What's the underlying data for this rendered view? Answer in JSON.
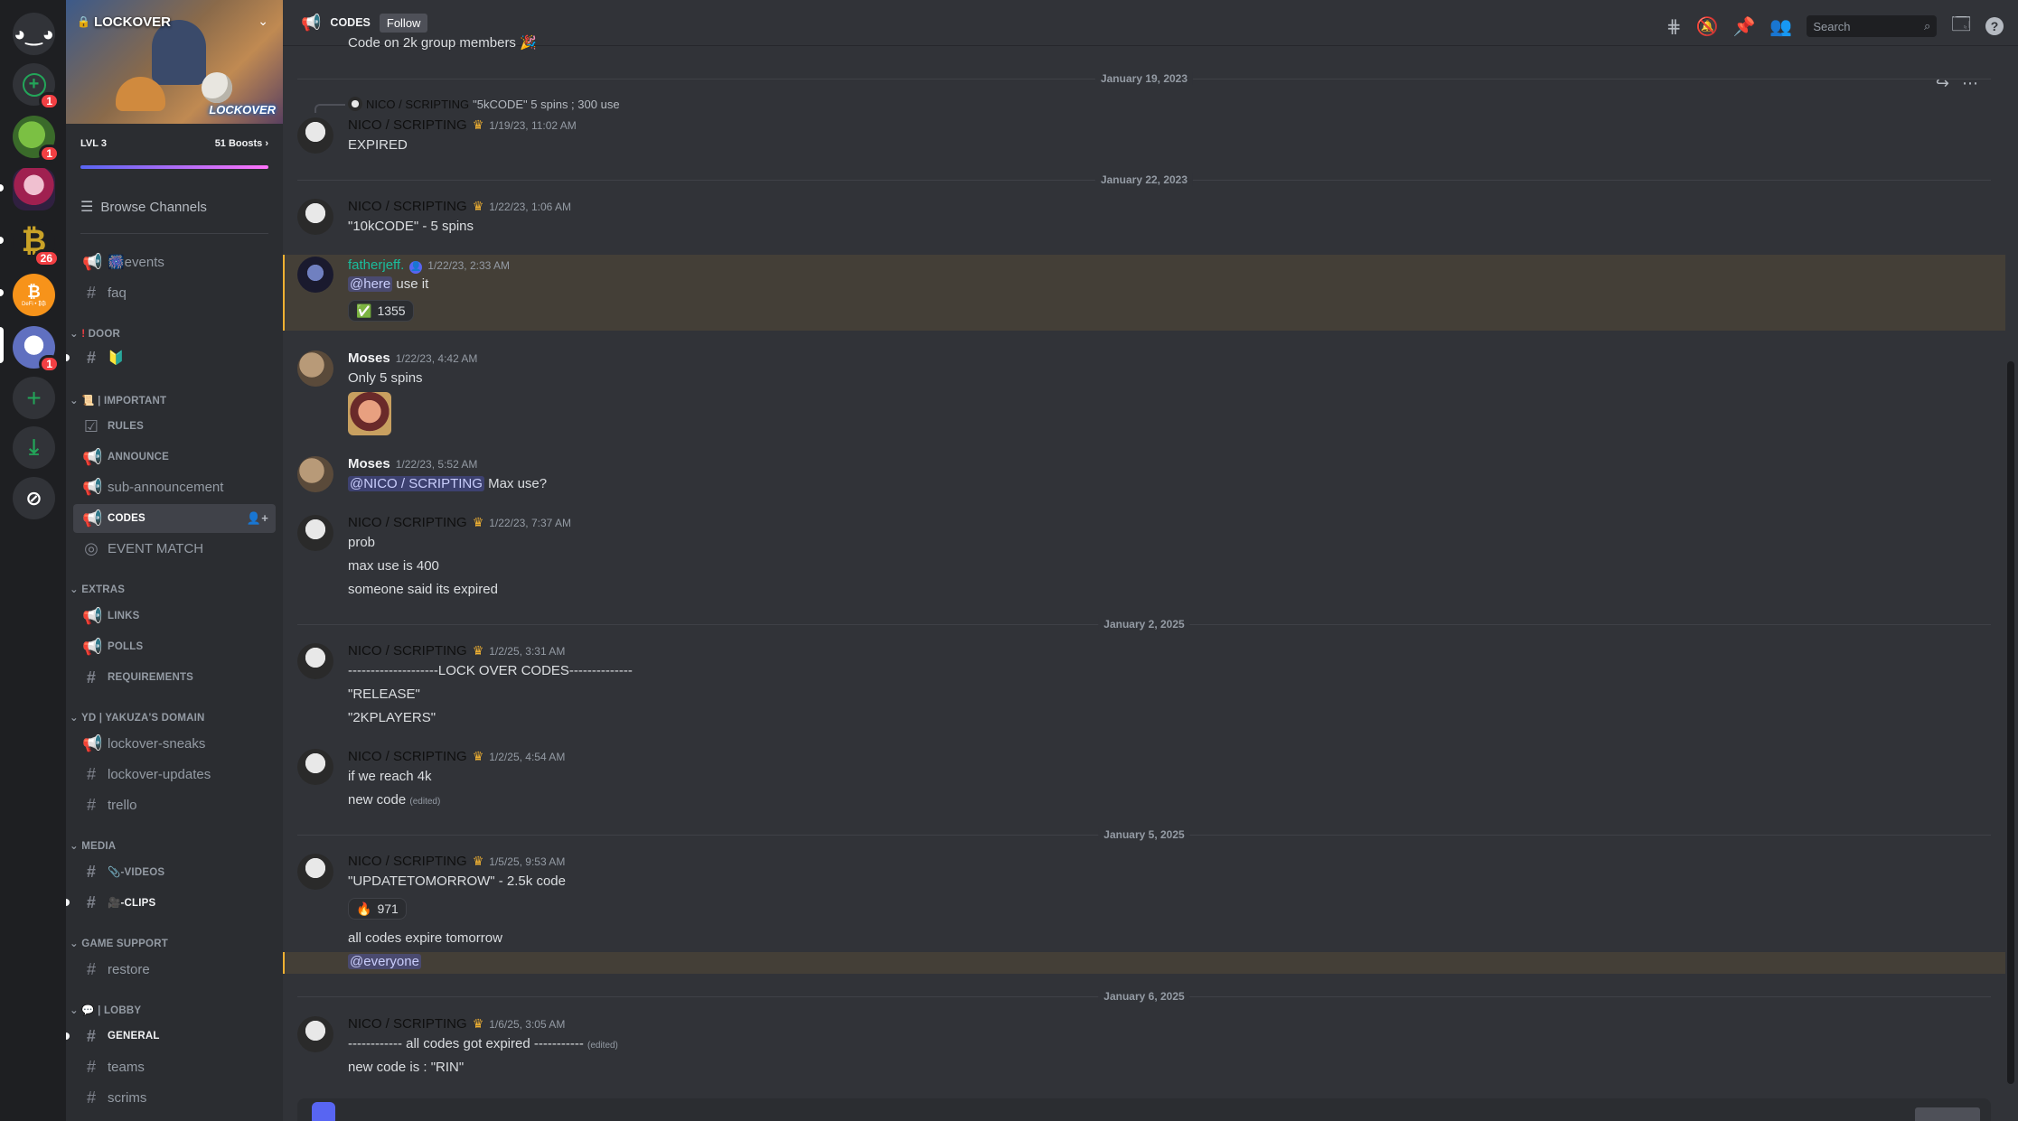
{
  "rail": {
    "servers": [
      {
        "name": "discord-home",
        "badge": ""
      },
      {
        "name": "add-server",
        "badge": "1"
      },
      {
        "name": "turtle-server",
        "badge": "1"
      },
      {
        "name": "anime-server",
        "badge": ""
      },
      {
        "name": "bitcoin-gold-server",
        "badge": "26"
      },
      {
        "name": "bitcoin-server",
        "badge": ""
      },
      {
        "name": "lockover-server",
        "badge": "1"
      }
    ],
    "btc_caption": "DeFi • ₿₿"
  },
  "guild": {
    "name": "LOCKOVER",
    "banner_logo": "LOCKOVER",
    "level": "LVL 3",
    "boosts": "51 Boosts"
  },
  "sidebar": {
    "browse": "Browse Channels",
    "top_channels": [
      {
        "icon": "megaphone",
        "label": "🎆events"
      },
      {
        "icon": "hash",
        "label": "faq"
      }
    ],
    "cat_door": "DOOR",
    "door_channel": "🔰",
    "cat_important": "📜 | IMPORTANT",
    "important": [
      "RULES",
      "ANNOUNCE",
      "sub-announcement",
      "CODES",
      "EVENT MATCH"
    ],
    "cat_extras": "EXTRAS",
    "extras": [
      "LINKS",
      "POLLS",
      "REQUIREMENTS"
    ],
    "cat_yakuza": "YD | YAKUZA'S DOMAIN",
    "yakuza": [
      "lockover-sneaks",
      "lockover-updates",
      "trello"
    ],
    "cat_media": "MEDIA",
    "media": [
      "📎-VIDEOS",
      "🎥-CLIPS"
    ],
    "cat_support": "GAME SUPPORT",
    "support": [
      "restore"
    ],
    "cat_lobby": "💬 | LOBBY",
    "lobby": [
      "GENERAL",
      "teams",
      "scrims"
    ]
  },
  "topbar": {
    "channel": "CODES",
    "follow": "Follow",
    "search_placeholder": "Search"
  },
  "messages": {
    "cut_text": "Code on 2k group members 🎉",
    "d1": "January 19, 2023",
    "reply_author": "NICO / SCRIPTING",
    "reply_text": "\"5kCODE\" 5 spins ; 300 use",
    "m1_author": "NICO / SCRIPTING",
    "m1_time": "1/19/23, 11:02 AM",
    "m1_text": "EXPIRED",
    "d2": "January 22, 2023",
    "m2_author": "NICO / SCRIPTING",
    "m2_time": "1/22/23, 1:06 AM",
    "m2_text": "\"10kCODE\" - 5 spins",
    "m3_author": "fatherjeff.",
    "m3_time": "1/22/23, 2:33 AM",
    "m3_mention": "@here",
    "m3_text": " use it",
    "m3_react_emoji": "✅",
    "m3_react_count": "1355",
    "m4_author": "Moses",
    "m4_time": "1/22/23, 4:42 AM",
    "m4_text": "Only 5 spins",
    "m5_author": "Moses",
    "m5_time": "1/22/23, 5:52 AM",
    "m5_mention": "@NICO / SCRIPTING",
    "m5_text": " Max use?",
    "m6_author": "NICO / SCRIPTING",
    "m6_time": "1/22/23, 7:37 AM",
    "m6_l1": "prob",
    "m6_l2": "max use is 400",
    "m6_l3": "someone said its expired",
    "d3": "January 2, 2025",
    "m7_author": "NICO / SCRIPTING",
    "m7_time": "1/2/25, 3:31 AM",
    "m7_l1": "--------------------LOCK OVER CODES--------------",
    "m7_l2": "\"RELEASE\"",
    "m7_l3": "\"2KPLAYERS\"",
    "m8_author": "NICO / SCRIPTING",
    "m8_time": "1/2/25, 4:54 AM",
    "m8_l1": "if we reach 4k",
    "m8_l2": "new code",
    "m8_edited": "(edited)",
    "d4": "January 5, 2025",
    "m9_author": "NICO / SCRIPTING",
    "m9_time": "1/5/25, 9:53 AM",
    "m9_l1": "\"UPDATETOMORROW\" - 2.5k code",
    "m9_react_emoji": "🔥",
    "m9_react_count": "971",
    "m9_l2": "all codes expire tomorrow",
    "m9_mention": "@everyone",
    "d5": "January 6, 2025",
    "m10_author": "NICO / SCRIPTING",
    "m10_time": "1/6/25, 3:05 AM",
    "m10_l1": "------------ all codes got expired -----------",
    "m10_edited": "(edited)",
    "m10_l2": "new code is : \"RIN\""
  },
  "colors": {
    "accent": "#5865f2",
    "highlight": "#f0b132",
    "fatherjeff": "#1abc9c"
  }
}
